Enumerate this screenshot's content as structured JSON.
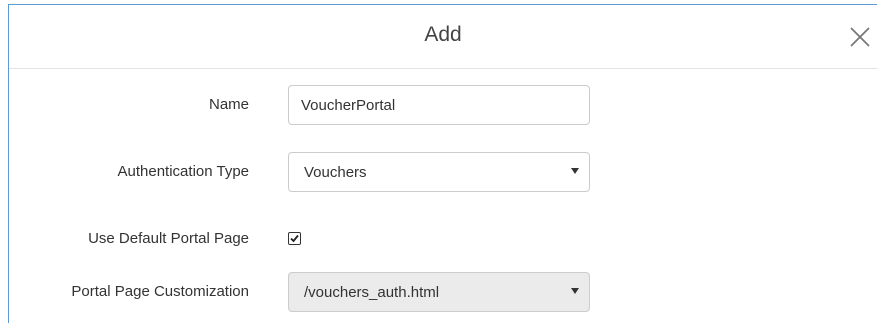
{
  "dialog": {
    "title": "Add",
    "close_icon": "close-icon"
  },
  "form": {
    "name": {
      "label": "Name",
      "value": "VoucherPortal"
    },
    "authentication_type": {
      "label": "Authentication Type",
      "selected": "Vouchers"
    },
    "use_default_portal_page": {
      "label": "Use Default Portal Page",
      "checked": true
    },
    "portal_page_customization": {
      "label": "Portal Page Customization",
      "selected": "/vouchers_auth.html",
      "disabled": true
    }
  },
  "colors": {
    "border_accent": "#5b9bd5",
    "disabled_bg": "#ebebeb"
  }
}
